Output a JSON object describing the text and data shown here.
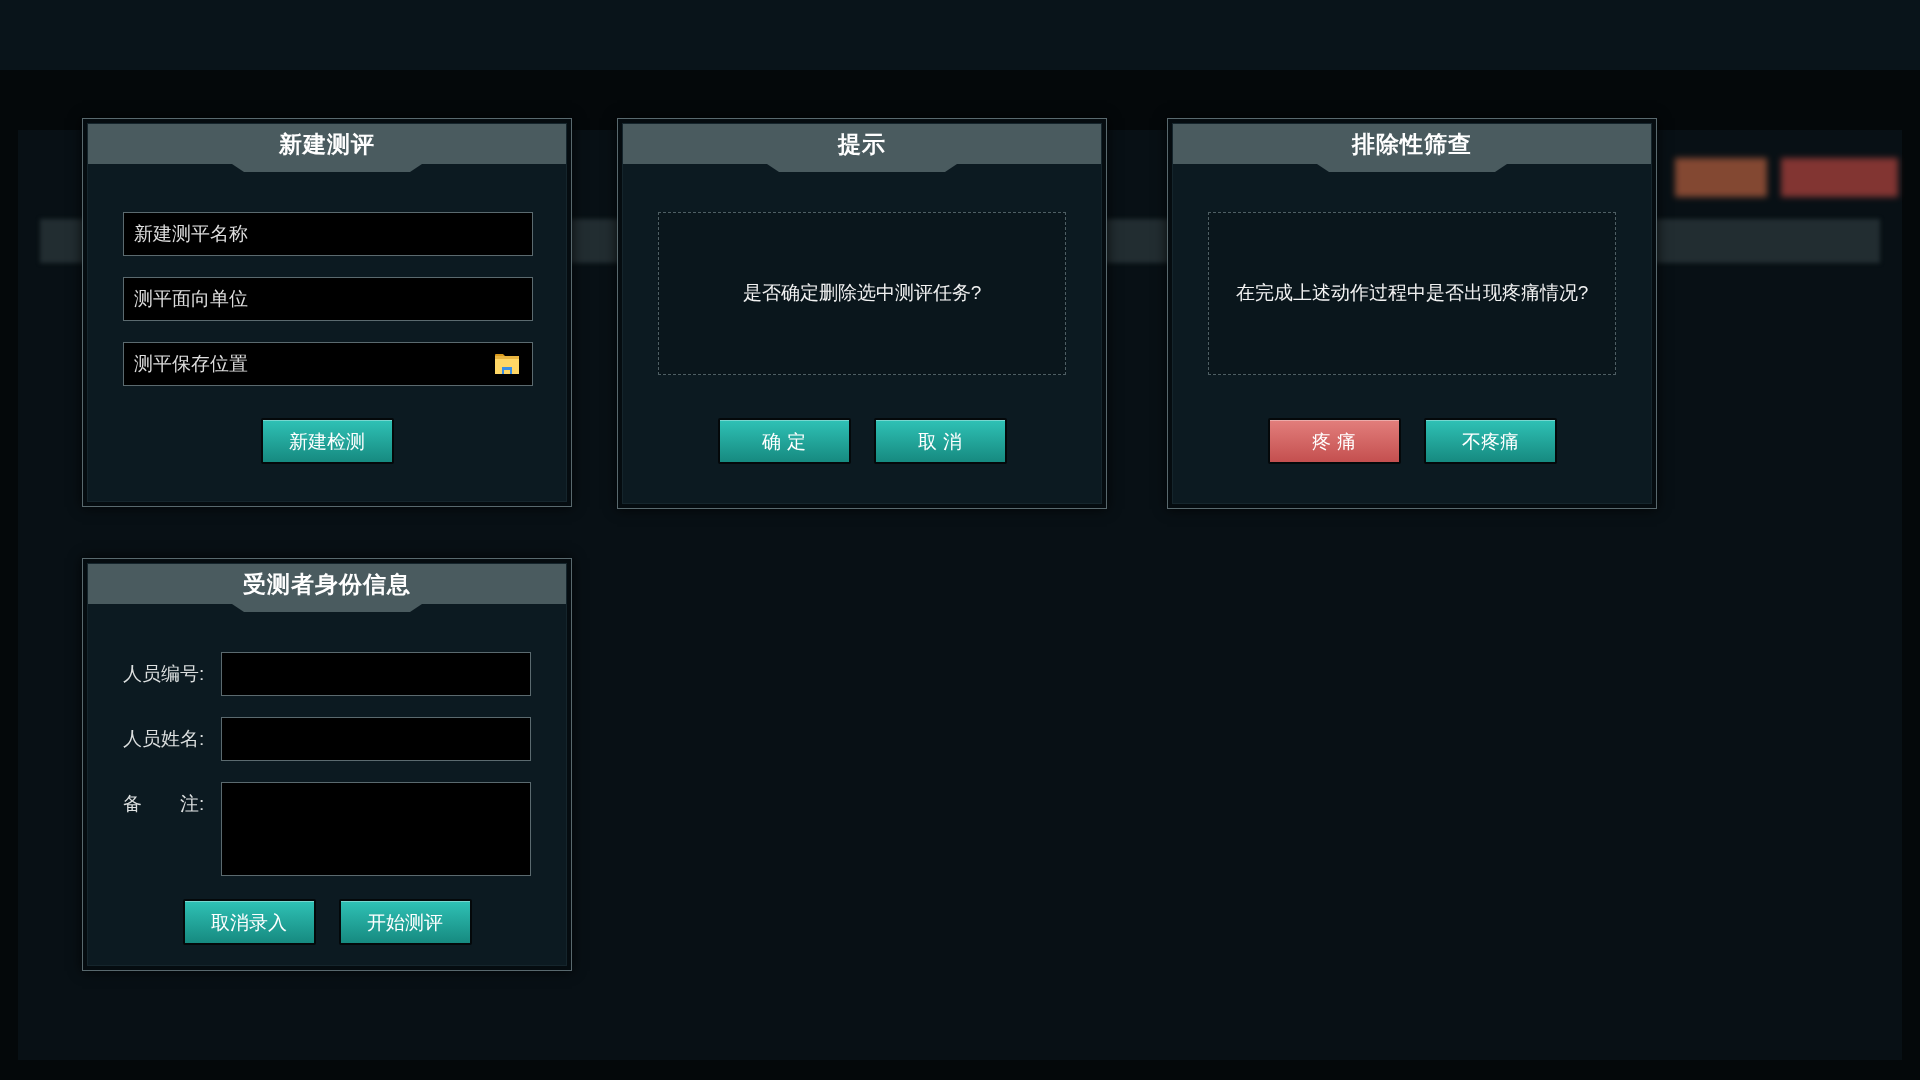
{
  "dialogs": [
    {
      "kind": "form",
      "title": "新建测评",
      "fields": [
        {
          "kind": "text",
          "placeholder": "新建测平名称"
        },
        {
          "kind": "text",
          "placeholder": "测平面向单位"
        },
        {
          "kind": "folder",
          "placeholder": "测平保存位置"
        }
      ],
      "buttons": [
        {
          "kind": "primary",
          "label": "新建检测"
        }
      ]
    },
    {
      "kind": "message",
      "title": "提示",
      "message": "是否确定删除选中测评任务?",
      "buttons": [
        {
          "kind": "primary",
          "label": "确 定"
        },
        {
          "kind": "primary",
          "label": "取 消"
        }
      ]
    },
    {
      "kind": "message",
      "title": "排除性筛查",
      "message": "在完成上述动作过程中是否出现疼痛情况?",
      "buttons": [
        {
          "kind": "danger",
          "label": "疼 痛"
        },
        {
          "kind": "primary",
          "label": "不疼痛"
        }
      ]
    },
    {
      "kind": "labeled_form",
      "title": "受测者身份信息",
      "fields": [
        {
          "kind": "input",
          "label": "人员编号:"
        },
        {
          "kind": "input",
          "label": "人员姓名:"
        },
        {
          "kind": "textarea",
          "label": "备　　注:"
        }
      ],
      "buttons": [
        {
          "kind": "primary",
          "label": "取消录入"
        },
        {
          "kind": "primary",
          "label": "开始测评"
        }
      ]
    }
  ]
}
